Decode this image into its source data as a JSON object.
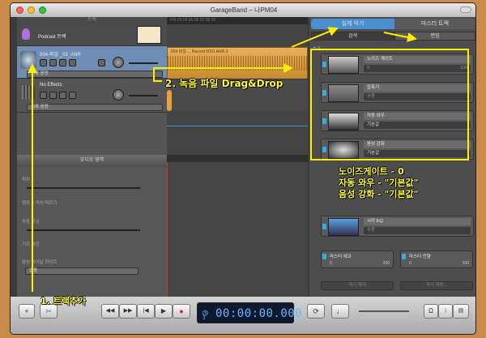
{
  "window": {
    "title": "GarageBand – 나PM04"
  },
  "tracks": {
    "header": "트랙",
    "items": [
      {
        "name": "Podcast 트랙"
      },
      {
        "name": "004-파일 _03_ANR",
        "dropdown": "기록 음량"
      },
      {
        "name": "No Effects",
        "dropdown": "기록 음량"
      }
    ]
  },
  "timeline": {
    "ruler": "PM 03 04 05 06 07 08 09",
    "region_title": "004 파일 ... Record 0001 ANR 3"
  },
  "right_panel": {
    "tab_left": "실제 악기",
    "tab_right": "마스터 트랙",
    "subtab_left": "검색",
    "subtab_right": "편집",
    "section_label": "효과",
    "effects": [
      {
        "name": "노이즈 게이트",
        "value": "0",
        "max": "100"
      },
      {
        "name": "압축기",
        "value": "수동"
      },
      {
        "name": "자동 와우",
        "value": "기본값"
      },
      {
        "name": "음성 강화",
        "value": "기본값"
      }
    ],
    "eq": {
      "name": "시각 EQ",
      "value": "수동"
    },
    "echo": {
      "name": "마스터 에코",
      "value": "0",
      "max": "100"
    },
    "reverb": {
      "name": "마스터 잔향",
      "value": "0",
      "max": "100"
    },
    "btn_delete": "악기 제거",
    "btn_save": "악기 저장..."
  },
  "editor": {
    "header": "오디오 영역",
    "labels": [
      "피치",
      "템포 & 피치 따르기",
      "자동 튜닝",
      "기조 제한",
      "음성 파이날 하이트",
      "없음"
    ]
  },
  "transport": {
    "time": "00:00:00.000",
    "counter": "3"
  },
  "annotations": {
    "add_track": "1. 트랙추가",
    "drag_drop": "2. 녹음 파일 Drag&Drop",
    "settings_line1": "노이즈게이트 - 0",
    "settings_line2": "자동 와우 - \"기본값\"",
    "settings_line3": "음성 강화 - \"기본값\""
  },
  "colors": {
    "accent": "#3aa9e0",
    "highlight": "#ffee00",
    "region": "#e8b15c"
  }
}
